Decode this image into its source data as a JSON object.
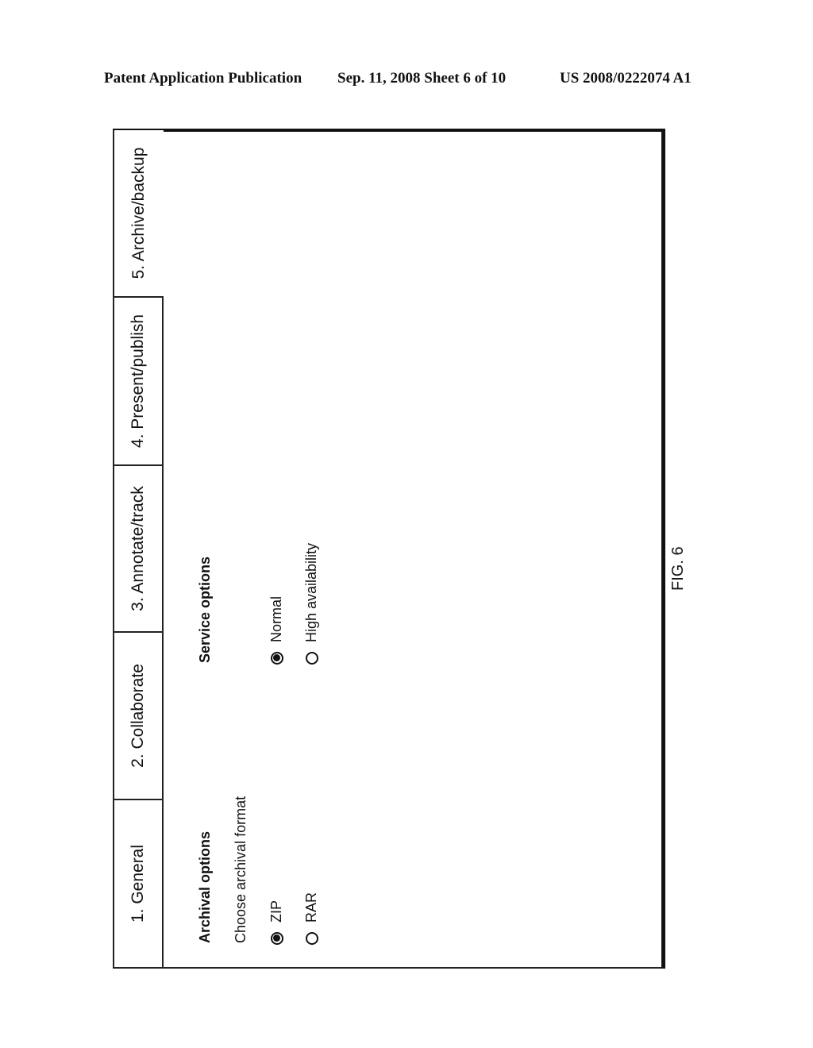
{
  "header": {
    "left": "Patent Application Publication",
    "middle": "Sep. 11, 2008   Sheet 6 of 10",
    "right": "US 2008/0222074 A1"
  },
  "tabs": [
    {
      "label": "1. General",
      "active": false
    },
    {
      "label": "2. Collaborate",
      "active": false
    },
    {
      "label": "3. Annotate/track",
      "active": false
    },
    {
      "label": "4. Present/publish",
      "active": false
    },
    {
      "label": "5. Archive/backup",
      "active": true
    }
  ],
  "archival": {
    "title": "Archival options",
    "subtitle": "Choose archival format",
    "options": [
      {
        "label": "ZIP",
        "selected": true
      },
      {
        "label": "RAR",
        "selected": false
      }
    ]
  },
  "service": {
    "title": "Service options",
    "options": [
      {
        "label": "Normal",
        "selected": true
      },
      {
        "label": "High availability",
        "selected": false
      }
    ]
  },
  "figure_label": "FIG. 6"
}
